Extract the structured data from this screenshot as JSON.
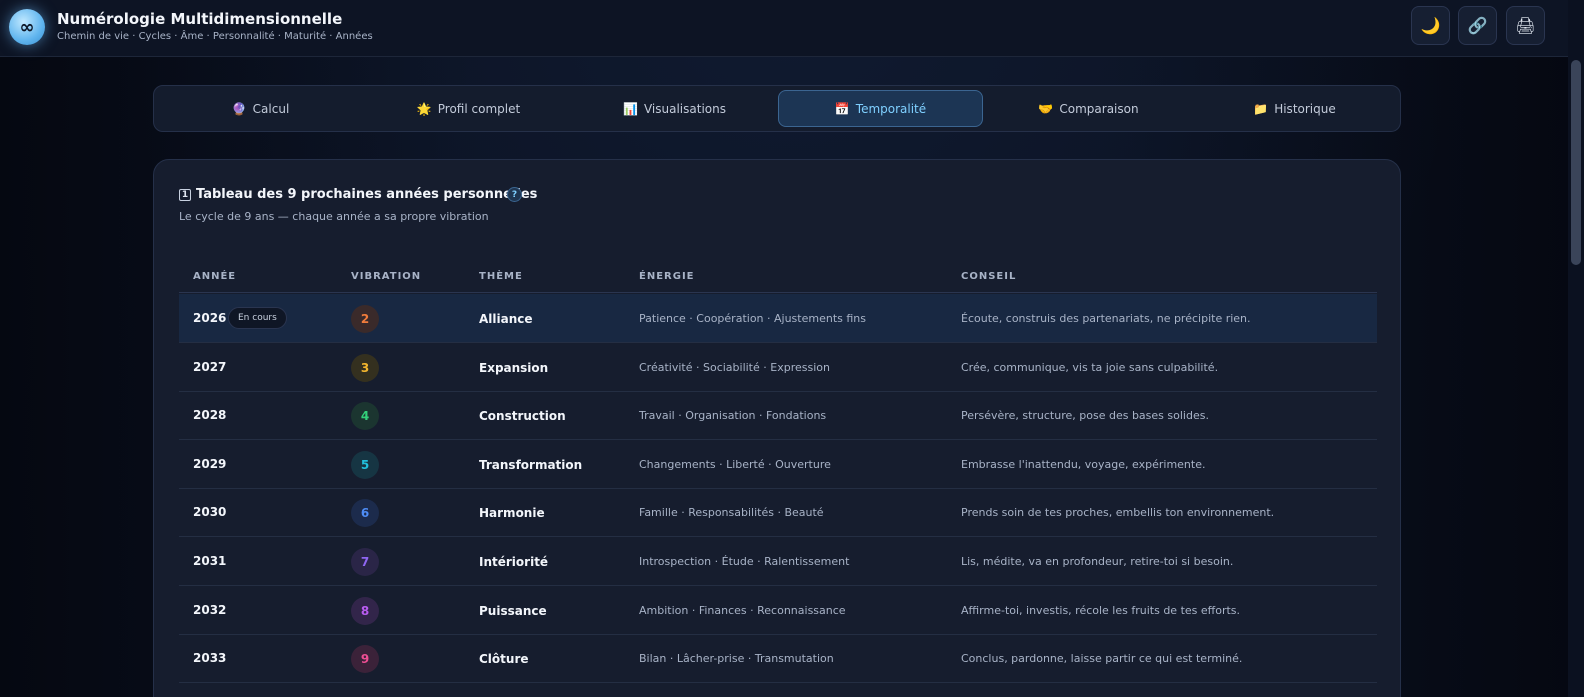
{
  "header": {
    "logo": "∞",
    "title": "Numérologie Multidimensionnelle",
    "subtitle": "Chemin de vie · Cycles · Âme · Personnalité · Maturité · Années",
    "buttons": [
      {
        "icon": "moon-icon",
        "glyph": "🌙"
      },
      {
        "icon": "link-icon",
        "glyph": "🔗"
      },
      {
        "icon": "print-icon",
        "glyph": "🖨"
      }
    ]
  },
  "tabs": [
    {
      "label": "Calcul",
      "glyph": "🔮",
      "icon": "crystal-ball-icon"
    },
    {
      "label": "Profil complet",
      "glyph": "🌟",
      "icon": "star-icon"
    },
    {
      "label": "Visualisations",
      "glyph": "📊",
      "icon": "chart-icon"
    },
    {
      "label": "Temporalité",
      "glyph": "📅",
      "icon": "calendar-icon",
      "active": true
    },
    {
      "label": "Comparaison",
      "glyph": "🤝",
      "icon": "handshake-icon"
    },
    {
      "label": "Historique",
      "glyph": "📁",
      "icon": "folder-icon"
    }
  ],
  "panel": {
    "title_icon": "1",
    "title": "Tableau des 9 prochaines années personnelles",
    "help": "?",
    "subtitle": "Le cycle de 9 ans — chaque année a sa propre vibration",
    "columns": [
      "ANNÉE",
      "VIBRATION",
      "THÈME",
      "ÉNERGIE",
      "CONSEIL"
    ],
    "current_badge": "En cours",
    "rows": [
      {
        "year": "2026",
        "vibration": "2",
        "theme": "Alliance",
        "energy": "Patience · Coopération · Ajustements fins",
        "advice": "Écoute, construis des partenariats, ne précipite rien.",
        "color": "#f07c3c",
        "bg": "#3a2a2a",
        "current": true
      },
      {
        "year": "2027",
        "vibration": "3",
        "theme": "Expansion",
        "energy": "Créativité · Sociabilité · Expression",
        "advice": "Crée, communique, vis ta joie sans culpabilité.",
        "color": "#f2b52e",
        "bg": "#34301f"
      },
      {
        "year": "2028",
        "vibration": "4",
        "theme": "Construction",
        "energy": "Travail · Organisation · Fondations",
        "advice": "Persévère, structure, pose des bases solides.",
        "color": "#33d07a",
        "bg": "#1b3530"
      },
      {
        "year": "2029",
        "vibration": "5",
        "theme": "Transformation",
        "energy": "Changements · Liberté · Ouverture",
        "advice": "Embrasse l'inattendu, voyage, expérimente.",
        "color": "#22c0dc",
        "bg": "#163543"
      },
      {
        "year": "2030",
        "vibration": "6",
        "theme": "Harmonie",
        "energy": "Famille · Responsabilités · Beauté",
        "advice": "Prends soin de tes proches, embellis ton environnement.",
        "color": "#4e8cf5",
        "bg": "#1c2b4c"
      },
      {
        "year": "2031",
        "vibration": "7",
        "theme": "Intériorité",
        "energy": "Introspection · Étude · Ralentissement",
        "advice": "Lis, médite, va en profondeur, retire-toi si besoin.",
        "color": "#8f66f2",
        "bg": "#2a2547"
      },
      {
        "year": "2032",
        "vibration": "8",
        "theme": "Puissance",
        "energy": "Ambition · Finances · Reconnaissance",
        "advice": "Affirme-toi, investis, récole les fruits de tes efforts.",
        "color": "#b85cf0",
        "bg": "#32254a"
      },
      {
        "year": "2033",
        "vibration": "9",
        "theme": "Clôture",
        "energy": "Bilan · Lâcher-prise · Transmutation",
        "advice": "Conclus, pardonne, laisse partir ce qui est terminé.",
        "color": "#ee4e93",
        "bg": "#3b2239"
      }
    ]
  }
}
